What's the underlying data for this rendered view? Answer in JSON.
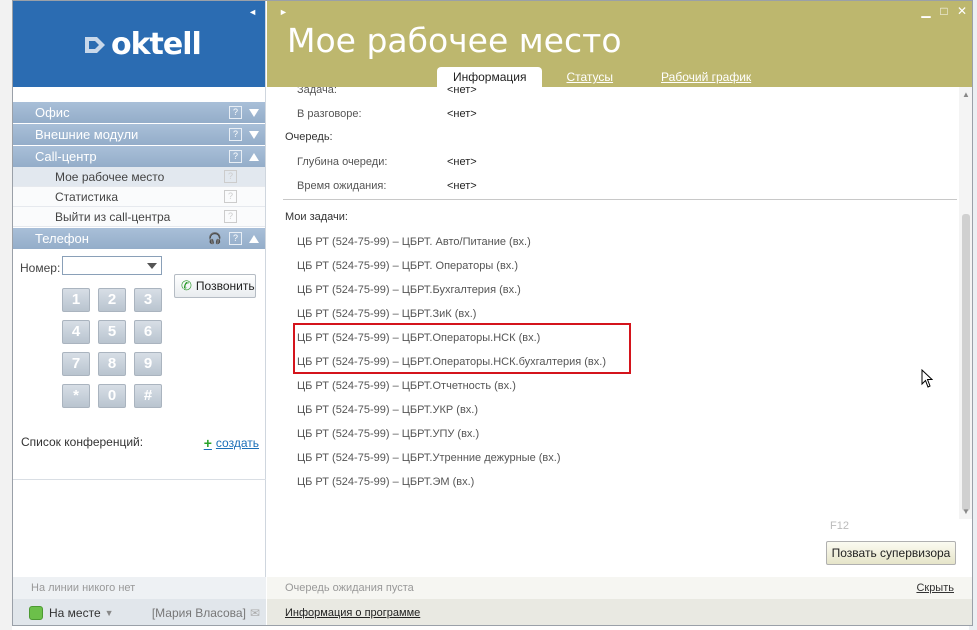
{
  "app": {
    "brand": "oktell",
    "title": "Мое рабочее место"
  },
  "tabs": [
    {
      "label": "Информация",
      "active": true
    },
    {
      "label": "Статусы",
      "active": false
    },
    {
      "label": "Рабочий график",
      "active": false
    }
  ],
  "sidebar": {
    "sections": [
      {
        "label": "Офис",
        "expanded": false
      },
      {
        "label": "Внешние модули",
        "expanded": false
      },
      {
        "label": "Call-центр",
        "expanded": true,
        "items": [
          {
            "label": "Мое рабочее место",
            "active": true
          },
          {
            "label": "Статистика",
            "active": false
          },
          {
            "label": "Выйти из call-центра",
            "active": false
          }
        ]
      },
      {
        "label": "Телефон",
        "expanded": true
      }
    ]
  },
  "phone": {
    "number_label": "Номер:",
    "number_value": "",
    "keys": [
      "1",
      "2",
      "3",
      "4",
      "5",
      "6",
      "7",
      "8",
      "9",
      "*",
      "0",
      "#"
    ],
    "call_label": "Позвонить"
  },
  "conferences": {
    "label": "Список конференций:",
    "create_label": "создать"
  },
  "info": {
    "task_label": "Задача:",
    "task_value": "<нет>",
    "talk_label": "В разговоре:",
    "talk_value": "<нет>",
    "queue_section": "Очередь:",
    "depth_label": "Глубина очереди:",
    "depth_value": "<нет>",
    "wait_label": "Время ожидания:",
    "wait_value": "<нет>",
    "my_tasks_section": "Мои задачи:"
  },
  "tasks": [
    "ЦБ РТ (524-75-99)  –  ЦБРТ. Авто/Питание (вх.)",
    "ЦБ РТ (524-75-99)  –  ЦБРТ. Операторы (вх.)",
    "ЦБ РТ (524-75-99)  –  ЦБРТ.Бухгалтерия (вх.)",
    "ЦБ РТ (524-75-99)  –  ЦБРТ.ЗиК (вх.)",
    "ЦБ РТ (524-75-99)  –  ЦБРТ.Операторы.НСК (вх.)",
    "ЦБ РТ (524-75-99)  –  ЦБРТ.Операторы.НСК.бухгалтерия (вх.)",
    "ЦБ РТ (524-75-99)  –  ЦБРТ.Отчетность (вх.)",
    "ЦБ РТ (524-75-99)  –  ЦБРТ.УКР (вх.)",
    "ЦБ РТ (524-75-99)  –  ЦБРТ.УПУ (вх.)",
    "ЦБ РТ (524-75-99)  –  ЦБРТ.Утренние дежурные (вх.)",
    "ЦБ РТ (524-75-99)  –  ЦБРТ.ЭМ (вх.)"
  ],
  "supervisor": {
    "hotkey": "F12",
    "button_label": "Позвать супервизора"
  },
  "status_bar": {
    "left_text": "На линии никого нет",
    "queue_text": "Очередь ожидания пуста",
    "hide_label": "Скрыть"
  },
  "footer": {
    "status": "На месте",
    "user": "[Мария Власова]",
    "about": "Информация о программе"
  },
  "colors": {
    "brand_blue": "#2b6cb2",
    "title_band": "#bdb76e",
    "highlight": "#d4141c",
    "status_green": "#6cc04a"
  }
}
